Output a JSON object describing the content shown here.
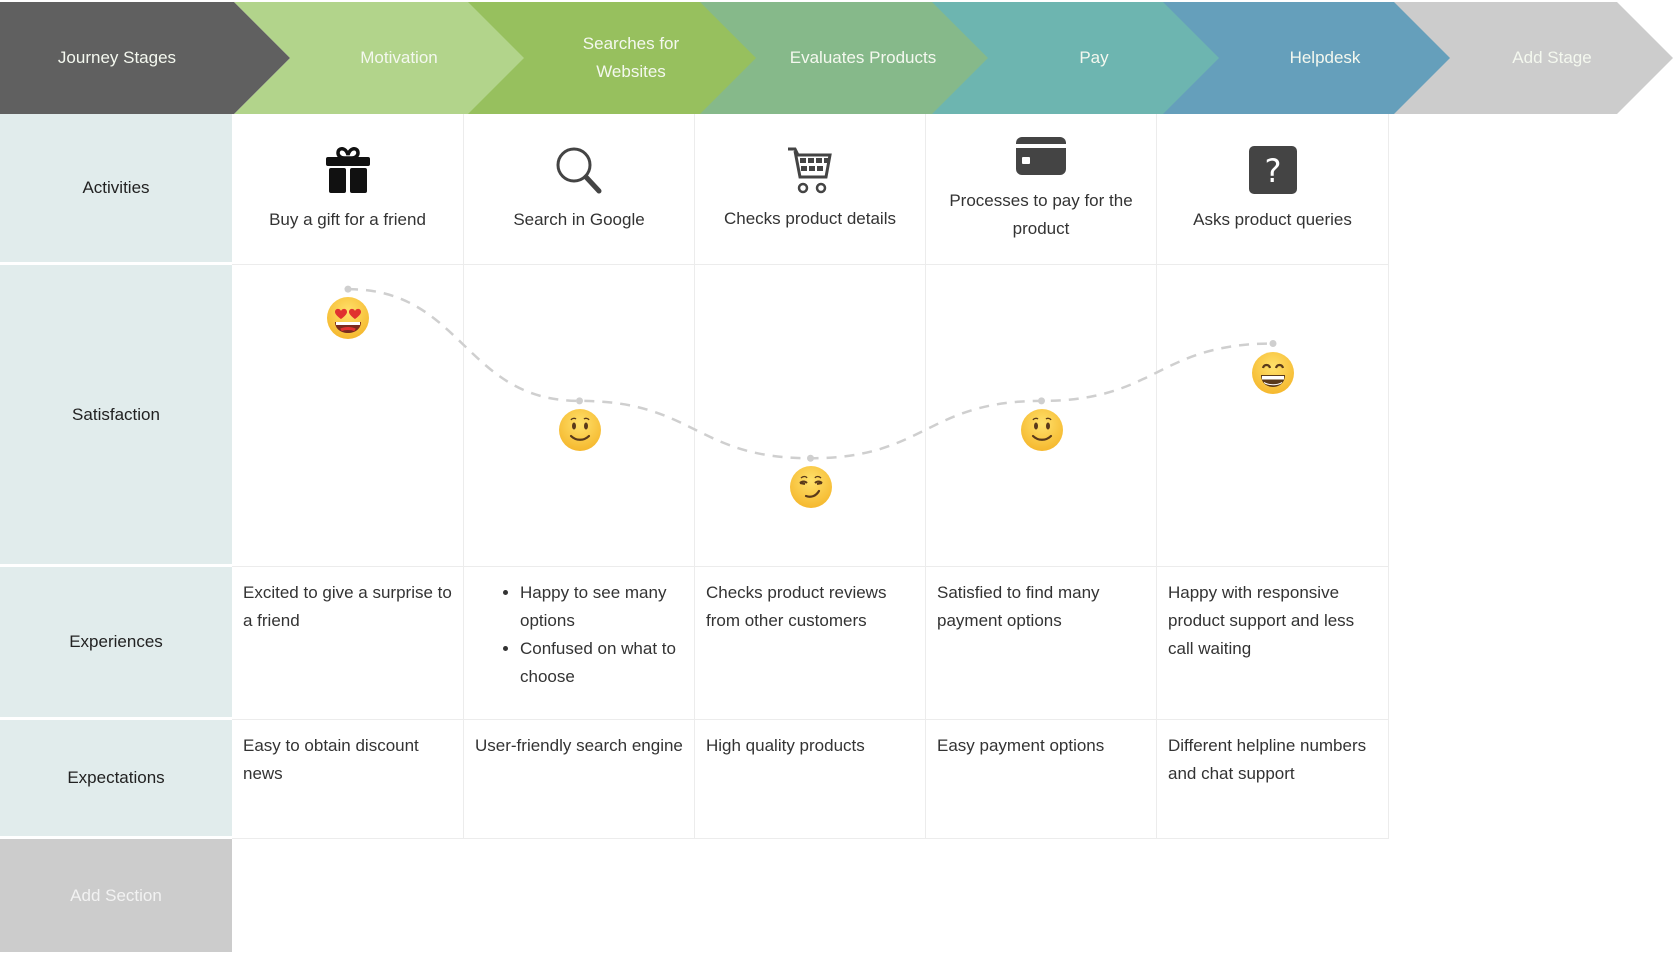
{
  "header": {
    "title_label": "Journey Stages",
    "stages": [
      {
        "label_lines": [
          "Motivation"
        ],
        "color": "#b2d48b"
      },
      {
        "label_lines": [
          "Searches for",
          "Websites"
        ],
        "color": "#97c05e"
      },
      {
        "label_lines": [
          "Evaluates Products"
        ],
        "color": "#86b98a"
      },
      {
        "label_lines": [
          "Pay"
        ],
        "color": "#6db5b0"
      },
      {
        "label_lines": [
          "Helpdesk"
        ],
        "color": "#659fbb"
      }
    ],
    "add_stage_label": "Add Stage",
    "title_color": "#606060",
    "add_stage_color": "#cccccc"
  },
  "sections": {
    "activities": "Activities",
    "satisfaction": "Satisfaction",
    "experiences": "Experiences",
    "expectations": "Expectations",
    "add_section": "Add Section"
  },
  "activities": [
    {
      "icon": "gift-icon",
      "text": "Buy a gift for a friend"
    },
    {
      "icon": "search-icon",
      "text": "Search in Google"
    },
    {
      "icon": "shopping-cart-icon",
      "text": "Checks product details"
    },
    {
      "icon": "credit-card-icon",
      "text": "Processes to pay for the product"
    },
    {
      "icon": "question-icon",
      "text": "Asks product queries"
    }
  ],
  "satisfaction": [
    {
      "emoji": "😍",
      "name": "heart-eyes-emoji-icon",
      "level": 0.92
    },
    {
      "emoji": "🙂",
      "name": "slightly-smiling-emoji-icon",
      "level": 0.55
    },
    {
      "emoji": "😏",
      "name": "smirking-emoji-icon",
      "level": 0.36
    },
    {
      "emoji": "🙂",
      "name": "slightly-smiling-emoji-icon",
      "level": 0.55
    },
    {
      "emoji": "😁",
      "name": "grinning-emoji-icon",
      "level": 0.74
    }
  ],
  "experiences": [
    {
      "text": "Excited to give a surprise to a friend"
    },
    {
      "bullets": [
        "Happy to see many options",
        "Confused on what to choose"
      ]
    },
    {
      "text": "Checks product reviews from other customers"
    },
    {
      "text": "Satisfied to find many payment options"
    },
    {
      "text": "Happy with responsive product support and less call waiting"
    }
  ],
  "expectations": [
    "Easy to obtain discount news",
    "User-friendly search engine",
    "High quality products",
    "Easy payment options",
    "Different helpline numbers and chat support"
  ]
}
